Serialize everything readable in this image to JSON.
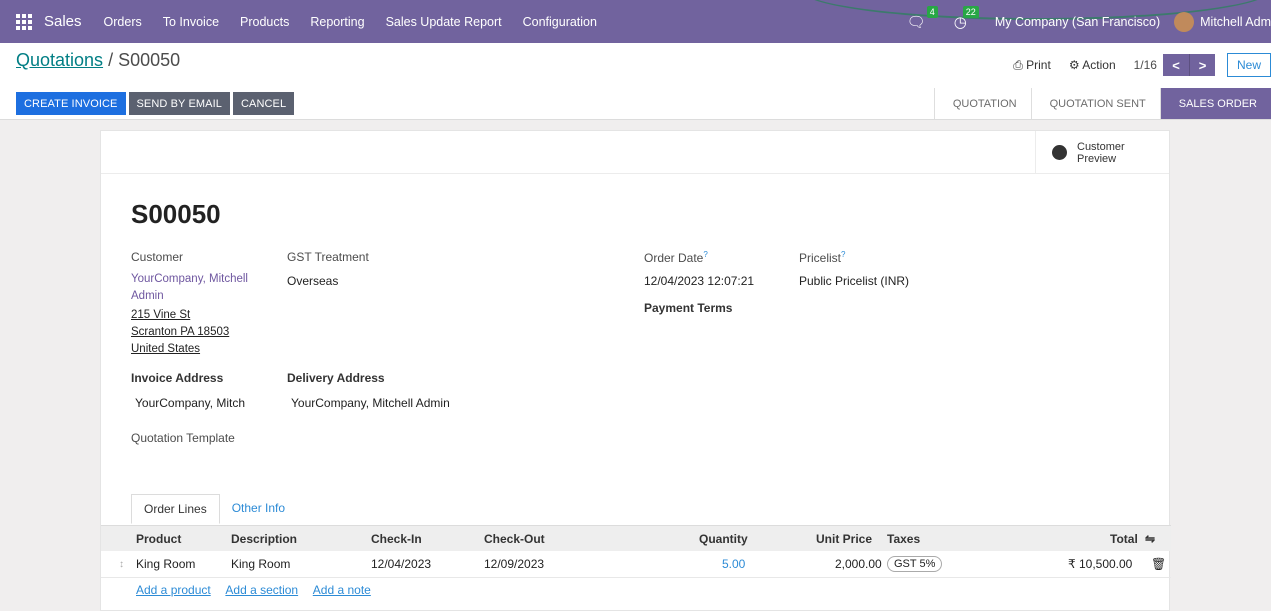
{
  "navbar": {
    "app_name": "Sales",
    "menus": [
      "Orders",
      "To Invoice",
      "Products",
      "Reporting",
      "Sales Update Report",
      "Configuration"
    ],
    "messages_count": "4",
    "activities_count": "22",
    "company": "My Company (San Francisco)",
    "user": "Mitchell Adm"
  },
  "breadcrumb": {
    "parent": "Quotations",
    "separator": " / ",
    "current": "S00050"
  },
  "toolbar": {
    "print": "Print",
    "action": "Action",
    "pager": "1/16",
    "prev": "<",
    "next": ">",
    "new": "New"
  },
  "actions": {
    "create_invoice": "CREATE INVOICE",
    "send_email": "SEND BY EMAIL",
    "cancel": "CANCEL"
  },
  "statusbar": {
    "steps": [
      "QUOTATION",
      "QUOTATION SENT",
      "SALES ORDER"
    ],
    "current": "SALES ORDER"
  },
  "preview": {
    "label": "Customer Preview"
  },
  "form": {
    "name": "S00050",
    "customer_label": "Customer",
    "customer_name_1": "YourCompany, Mitchell",
    "customer_name_2": "Admin",
    "address_1": "215 Vine St",
    "address_2": "Scranton PA 18503",
    "address_3": "United States",
    "gst_label": "GST Treatment",
    "gst_value": "Overseas",
    "order_date_label": "Order Date",
    "order_date_value": "12/04/2023 12:07:21",
    "pricelist_label": "Pricelist",
    "pricelist_value": "Public Pricelist (INR)",
    "payment_terms_label": "Payment Terms",
    "invoice_address_label": "Invoice Address",
    "invoice_address_value": "YourCompany, Mitch",
    "delivery_address_label": "Delivery Address",
    "delivery_address_value": "YourCompany, Mitchell Admin",
    "quotation_template_label": "Quotation Template",
    "help_mark": "?"
  },
  "tabs": [
    "Order Lines",
    "Other Info"
  ],
  "order_lines": {
    "columns": [
      "Product",
      "Description",
      "Check-In",
      "Check-Out",
      "Quantity",
      "Unit Price",
      "Taxes",
      "Total"
    ],
    "rows": [
      {
        "product": "King Room",
        "description": "King Room",
        "check_in": "12/04/2023",
        "check_out": "12/09/2023",
        "quantity": "5.00",
        "unit_price": "2,000.00",
        "taxes": "GST 5%",
        "total": "₹ 10,500.00"
      }
    ],
    "add_product": "Add a product",
    "add_section": "Add a section",
    "add_note": "Add a note"
  },
  "colors": {
    "brand": "#71639e",
    "primary_button": "#1d6fe0",
    "link": "#2c8bd6"
  }
}
